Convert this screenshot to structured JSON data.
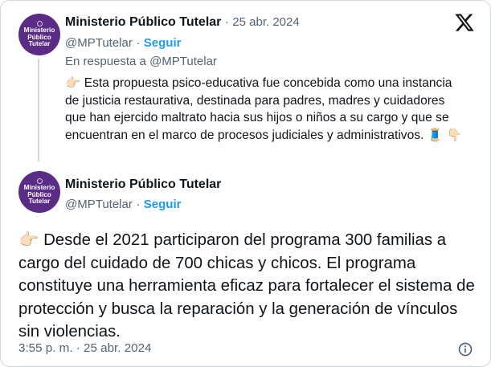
{
  "reply_tweet": {
    "author_name": "Ministerio Público Tutelar",
    "date": "25 abr. 2024",
    "separator": "·",
    "handle": "@MPTutelar",
    "follow_label": "Seguir",
    "in_reply_to": "En respuesta a @MPTutelar",
    "pointer_emoji": "👉🏻",
    "body": "Esta propuesta psico-educativa fue concebida como una instancia de justicia restaurativa, destinada para padres, madres y cuidadores que han ejercido maltrato hacia sus hijos o niños a su cargo y que se encuentran en el marco de procesos judiciales y administrativos.",
    "end_emoji_1": "🧵",
    "end_emoji_2": "👇🏻"
  },
  "main_tweet": {
    "author_name": "Ministerio Público Tutelar",
    "handle": "@MPTutelar",
    "separator": "·",
    "follow_label": "Seguir",
    "pointer_emoji": "👉🏻",
    "body": "Desde el 2021 participaron del programa 300 familias a cargo del cuidado de 700 chicas y chicos. El programa constituye una herramienta eficaz para fortalecer el sistema de protección y busca la reparación y la generación de vínculos sin violencias.",
    "timestamp": "3:55 p. m. · 25 abr. 2024"
  },
  "avatar": {
    "line1": "Ministerio",
    "line2": "Público",
    "line3": "Tutelar",
    "color": "#5a2c86"
  },
  "icons": {
    "platform_logo": "x-logo-icon",
    "info": "info-icon"
  },
  "colors": {
    "link": "#1d9bf0",
    "muted": "#536471",
    "text": "#0f1419",
    "border": "#cfd9de"
  }
}
